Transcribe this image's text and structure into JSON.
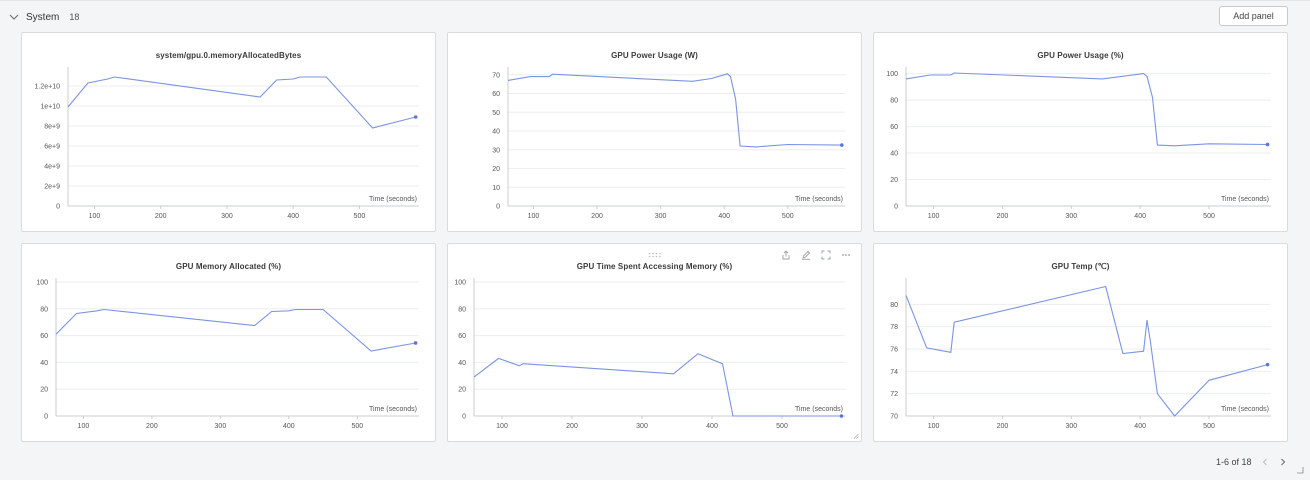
{
  "section": {
    "title": "System",
    "count": "18",
    "add_panel_label": "Add panel"
  },
  "pagination": {
    "label": "1-6 of 18"
  },
  "colors": {
    "series": "#7b93e2",
    "endpoint": "#5a77d8",
    "panel_border": "#d9dbde"
  },
  "chart_data": [
    {
      "type": "line",
      "title": "system/gpu.0.memoryAllocatedBytes",
      "xlabel": "Time (seconds)",
      "xlim": [
        60,
        590
      ],
      "xticks": [
        100,
        200,
        300,
        400,
        500
      ],
      "ylim": [
        0,
        13500000000
      ],
      "yticks": [
        0,
        2000000000,
        4000000000,
        6000000000,
        8000000000,
        10000000000,
        12000000000
      ],
      "ytick_labels": [
        "0",
        "2e+9",
        "4e+9",
        "6e+9",
        "8e+9",
        "1e+10",
        "1.2e+10"
      ],
      "grid": true,
      "x": [
        60,
        90,
        120,
        130,
        350,
        375,
        400,
        410,
        450,
        520,
        585
      ],
      "y": [
        9900000000.0,
        12300000000.0,
        12700000000.0,
        12900000000.0,
        10900000000.0,
        12600000000.0,
        12700000000.0,
        12900000000.0,
        12900000000.0,
        7800000000.0,
        8900000000.0
      ]
    },
    {
      "type": "line",
      "title": "GPU Power Usage (W)",
      "xlabel": "Time (seconds)",
      "xlim": [
        60,
        590
      ],
      "xticks": [
        100,
        200,
        300,
        400,
        500
      ],
      "ylim": [
        0,
        72
      ],
      "yticks": [
        0,
        10,
        20,
        30,
        40,
        50,
        60,
        70
      ],
      "ytick_labels": [
        "0",
        "10",
        "20",
        "30",
        "40",
        "50",
        "60",
        "70"
      ],
      "grid": true,
      "x": [
        60,
        95,
        115,
        125,
        130,
        350,
        380,
        405,
        410,
        418,
        425,
        450,
        500,
        585
      ],
      "y": [
        67,
        69,
        69,
        69,
        70.3,
        66.5,
        68,
        70.5,
        69,
        57,
        32,
        31.5,
        32.8,
        32.5
      ]
    },
    {
      "type": "line",
      "title": "GPU Power Usage (%)",
      "xlabel": "Time (seconds)",
      "xlim": [
        60,
        590
      ],
      "xticks": [
        100,
        200,
        300,
        400,
        500
      ],
      "ylim": [
        0,
        102
      ],
      "yticks": [
        0,
        20,
        40,
        60,
        80,
        100
      ],
      "ytick_labels": [
        "0",
        "20",
        "40",
        "60",
        "80",
        "100"
      ],
      "grid": true,
      "x": [
        60,
        95,
        125,
        130,
        345,
        405,
        410,
        418,
        425,
        450,
        500,
        585
      ],
      "y": [
        96,
        99,
        99,
        100.5,
        96,
        100,
        98,
        82,
        46,
        45.5,
        47,
        46.5
      ]
    },
    {
      "type": "line",
      "title": "GPU Memory Allocated (%)",
      "xlabel": "Time (seconds)",
      "xlim": [
        60,
        590
      ],
      "xticks": [
        100,
        200,
        300,
        400,
        500
      ],
      "ylim": [
        0,
        100
      ],
      "yticks": [
        0,
        20,
        40,
        60,
        80,
        100
      ],
      "ytick_labels": [
        "0",
        "20",
        "40",
        "60",
        "80",
        "100"
      ],
      "grid": true,
      "x": [
        60,
        90,
        120,
        130,
        350,
        375,
        400,
        410,
        450,
        520,
        585
      ],
      "y": [
        61,
        76.5,
        78.5,
        79.5,
        67.5,
        78,
        78.5,
        79.5,
        79.5,
        48.5,
        54.5
      ]
    },
    {
      "type": "line",
      "title": "GPU Time Spent Accessing Memory (%)",
      "xlabel": "Time (seconds)",
      "xlim": [
        60,
        590
      ],
      "xticks": [
        100,
        200,
        300,
        400,
        500
      ],
      "ylim": [
        0,
        100
      ],
      "yticks": [
        0,
        20,
        40,
        60,
        80,
        100
      ],
      "ytick_labels": [
        "0",
        "20",
        "40",
        "60",
        "80",
        "100"
      ],
      "grid": true,
      "x": [
        60,
        95,
        125,
        130,
        345,
        380,
        410,
        415,
        430,
        585
      ],
      "y": [
        29,
        43,
        37.5,
        39,
        31.5,
        46.5,
        40,
        39,
        0,
        0
      ]
    },
    {
      "type": "line",
      "title": "GPU Temp (℃)",
      "xlabel": "Time (seconds)",
      "xlim": [
        60,
        590
      ],
      "xticks": [
        100,
        200,
        300,
        400,
        500
      ],
      "ylim": [
        70,
        82
      ],
      "yticks": [
        70,
        72,
        74,
        76,
        78,
        80
      ],
      "ytick_labels": [
        "70",
        "72",
        "74",
        "76",
        "78",
        "80"
      ],
      "grid": true,
      "x": [
        60,
        90,
        125,
        130,
        350,
        375,
        405,
        410,
        415,
        425,
        450,
        500,
        585
      ],
      "y": [
        80.8,
        76.1,
        75.7,
        78.4,
        81.6,
        75.6,
        75.8,
        78.6,
        76.6,
        72,
        70,
        73.2,
        74.6
      ]
    }
  ]
}
